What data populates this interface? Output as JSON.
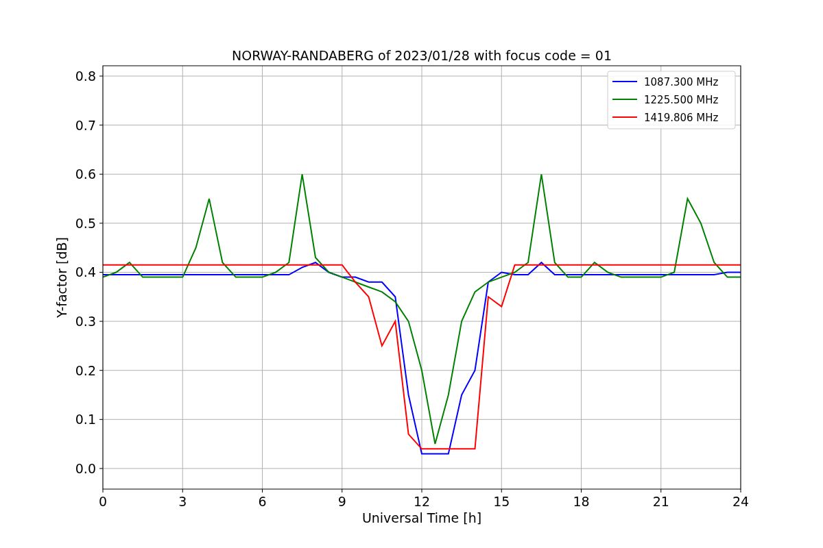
{
  "figure": {
    "chart_data": {
      "type": "line",
      "title": "NORWAY-RANDABERG of 2023/01/28 with focus code = 01",
      "xlabel": "Universal Time [h]",
      "ylabel": "Y-factor [dB]",
      "grid": true,
      "legend": true,
      "xlim": [
        0,
        24
      ],
      "ylim": [
        -0.042,
        0.821
      ],
      "xticks": [
        0,
        3,
        6,
        9,
        12,
        15,
        18,
        21,
        24
      ],
      "yticks": [
        {
          "value": 0,
          "label": "0.0"
        },
        {
          "value": 0.1,
          "label": "0.1"
        },
        {
          "value": 0.2,
          "label": "0.2"
        },
        {
          "value": 0.3,
          "label": "0.3"
        },
        {
          "value": 0.4,
          "label": "0.4"
        },
        {
          "value": 0.5,
          "label": "0.5"
        },
        {
          "value": 0.6,
          "label": "0.6"
        },
        {
          "value": 0.7,
          "label": "0.7"
        },
        {
          "value": 0.8,
          "label": "0.8"
        }
      ],
      "x": [
        0,
        0.5,
        1,
        1.5,
        2,
        2.5,
        3,
        3.5,
        4,
        4.5,
        5,
        5.5,
        6,
        6.5,
        7,
        7.5,
        8,
        8.5,
        9,
        9.5,
        10,
        10.5,
        11,
        11.5,
        12,
        12.5,
        13,
        13.5,
        14,
        14.5,
        15,
        15.5,
        16,
        16.5,
        17,
        17.5,
        18,
        18.5,
        19,
        19.5,
        20,
        20.5,
        21,
        21.5,
        22,
        22.5,
        23,
        23.5,
        24
      ],
      "series": [
        {
          "name": "1087.300 MHz",
          "color": "#0000ff",
          "values": [
            0.395,
            0.395,
            0.395,
            0.395,
            0.395,
            0.395,
            0.395,
            0.395,
            0.395,
            0.395,
            0.395,
            0.395,
            0.395,
            0.395,
            0.395,
            0.41,
            0.42,
            0.4,
            0.39,
            0.39,
            0.38,
            0.38,
            0.35,
            0.15,
            0.03,
            0.03,
            0.03,
            0.15,
            0.2,
            0.38,
            0.4,
            0.395,
            0.395,
            0.42,
            0.395,
            0.395,
            0.395,
            0.395,
            0.395,
            0.395,
            0.395,
            0.395,
            0.395,
            0.395,
            0.395,
            0.395,
            0.395,
            0.4,
            0.4
          ]
        },
        {
          "name": "1225.500 MHz",
          "color": "#008000",
          "values": [
            0.39,
            0.4,
            0.42,
            0.39,
            0.39,
            0.39,
            0.39,
            0.45,
            0.55,
            0.42,
            0.39,
            0.39,
            0.39,
            0.4,
            0.42,
            0.6,
            0.43,
            0.4,
            0.39,
            0.38,
            0.37,
            0.36,
            0.34,
            0.3,
            0.2,
            0.05,
            0.15,
            0.3,
            0.36,
            0.38,
            0.39,
            0.4,
            0.42,
            0.6,
            0.42,
            0.39,
            0.39,
            0.42,
            0.4,
            0.39,
            0.39,
            0.39,
            0.39,
            0.4,
            0.55,
            0.5,
            0.42,
            0.39,
            0.39
          ]
        },
        {
          "name": "1419.806 MHz",
          "color": "#ff0000",
          "values": [
            0.415,
            0.415,
            0.415,
            0.415,
            0.415,
            0.415,
            0.415,
            0.415,
            0.415,
            0.415,
            0.415,
            0.415,
            0.415,
            0.415,
            0.415,
            0.415,
            0.415,
            0.415,
            0.415,
            0.38,
            0.35,
            0.25,
            0.3,
            0.07,
            0.04,
            0.04,
            0.04,
            0.04,
            0.04,
            0.35,
            0.33,
            0.415,
            0.415,
            0.415,
            0.415,
            0.415,
            0.415,
            0.415,
            0.415,
            0.415,
            0.415,
            0.415,
            0.415,
            0.415,
            0.415,
            0.415,
            0.415,
            0.415,
            0.415
          ]
        }
      ]
    }
  }
}
